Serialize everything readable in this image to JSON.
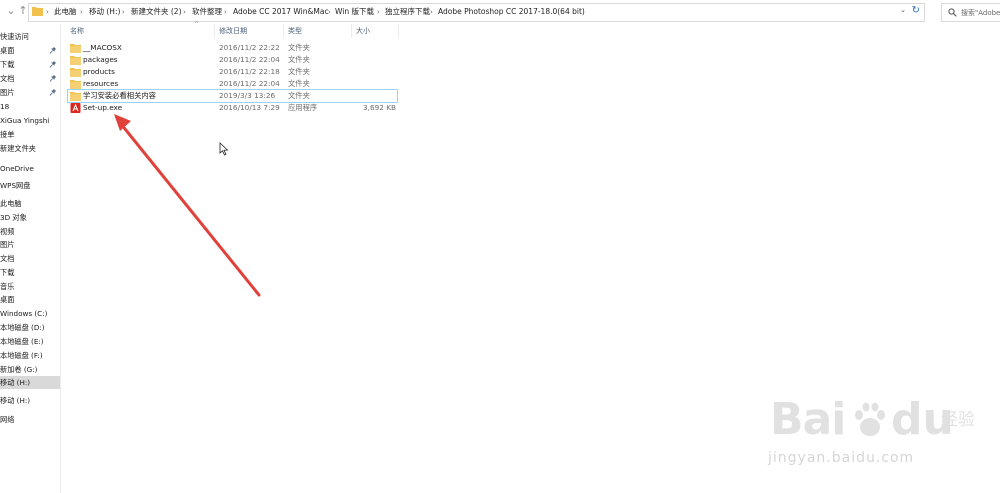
{
  "address_bar": {
    "crumbs": [
      "此电脑",
      "移动 (H:)",
      "新建文件夹 (2)",
      "软件整理",
      "Adobe CC 2017 Win&Mac",
      "Win 版下载",
      "独立程序下载",
      "Adobe Photoshop CC 2017-18.0(64 bit)"
    ],
    "separator": "›"
  },
  "search": {
    "placeholder": "搜索\"Adobe Pho"
  },
  "nav_pane": {
    "items": [
      {
        "label": "快速访问",
        "pinned": false
      },
      {
        "label": "桌面",
        "pinned": true
      },
      {
        "label": "下载",
        "pinned": true
      },
      {
        "label": "文档",
        "pinned": true
      },
      {
        "label": "图片",
        "pinned": true
      },
      {
        "label": "18",
        "pinned": false
      },
      {
        "label": "XiGua Yingshi",
        "pinned": false
      },
      {
        "label": "接单",
        "pinned": false
      },
      {
        "label": "新建文件夹",
        "pinned": false
      },
      {
        "label": "OneDrive",
        "pinned": false
      },
      {
        "label": "WPS网盘",
        "pinned": false
      },
      {
        "label": "此电脑",
        "pinned": false
      },
      {
        "label": "3D 对象",
        "pinned": false
      },
      {
        "label": "视频",
        "pinned": false
      },
      {
        "label": "图片",
        "pinned": false
      },
      {
        "label": "文档",
        "pinned": false
      },
      {
        "label": "下载",
        "pinned": false
      },
      {
        "label": "音乐",
        "pinned": false
      },
      {
        "label": "桌面",
        "pinned": false
      },
      {
        "label": "Windows (C:)",
        "pinned": false
      },
      {
        "label": "本地磁盘 (D:)",
        "pinned": false
      },
      {
        "label": "本地磁盘 (E:)",
        "pinned": false
      },
      {
        "label": "本地磁盘 (F:)",
        "pinned": false
      },
      {
        "label": "新加卷 (G:)",
        "pinned": false
      },
      {
        "label": "移动 (H:)",
        "pinned": false
      },
      {
        "label": "移动 (H:)",
        "pinned": false
      },
      {
        "label": "网络",
        "pinned": false
      }
    ],
    "selected_index": 24
  },
  "columns": {
    "name": "名称",
    "date": "修改日期",
    "type": "类型",
    "size": "大小"
  },
  "files": [
    {
      "name": "__MACOSX",
      "date": "2016/11/2 22:22",
      "type": "文件夹",
      "size": "",
      "icon": "folder-icon"
    },
    {
      "name": "packages",
      "date": "2016/11/2 22:04",
      "type": "文件夹",
      "size": "",
      "icon": "folder-icon"
    },
    {
      "name": "products",
      "date": "2016/11/2 22:18",
      "type": "文件夹",
      "size": "",
      "icon": "folder-icon"
    },
    {
      "name": "resources",
      "date": "2016/11/2 22:04",
      "type": "文件夹",
      "size": "",
      "icon": "folder-icon"
    },
    {
      "name": "学习安装必看相关内容",
      "date": "2019/3/3 13:26",
      "type": "文件夹",
      "size": "",
      "icon": "folder-icon"
    },
    {
      "name": "Set-up.exe",
      "date": "2016/10/13 7:29",
      "type": "应用程序",
      "size": "3,692 KB",
      "icon": "adobe-setup-icon"
    }
  ],
  "selected_file_index": 4,
  "watermark": {
    "brand": "Bai",
    "brand2": "du",
    "cn": "经验",
    "url": "jingyan.baidu.com"
  },
  "colors": {
    "folder": "#f0c24b",
    "adobe_red": "#d8281f",
    "arrow": "#e0413a",
    "selection": "#99d1ff"
  }
}
